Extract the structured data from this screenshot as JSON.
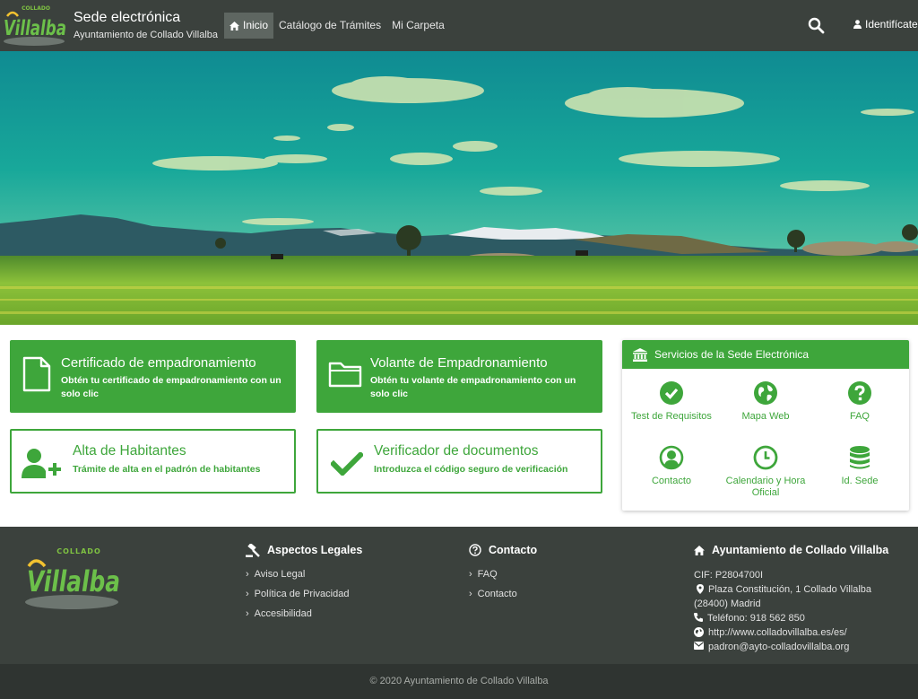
{
  "header": {
    "logo_text": "Villalba",
    "logo_small": "COLLADO",
    "title": "Sede electrónica",
    "subtitle": "Ayuntamiento de Collado Villalba",
    "nav": [
      {
        "label": "Inicio"
      },
      {
        "label": "Catálogo de Trámites"
      },
      {
        "label": "Mi Carpeta"
      }
    ],
    "login_label": "Identifícate",
    "icons": {
      "home": "home-icon",
      "search": "search-icon",
      "user": "user-icon"
    }
  },
  "cards": [
    {
      "title": "Certificado de empadronamiento",
      "desc": "Obtén tu certificado de empadronamiento con un solo clic",
      "icon": "file-icon"
    },
    {
      "title": "Volante de Empadronamiento",
      "desc": "Obtén tu volante de empadronamiento con un solo clic",
      "icon": "folder-icon"
    },
    {
      "title": "Alta de Habitantes",
      "desc": "Trámite de alta en el padrón de habitantes",
      "icon": "user-plus-icon"
    },
    {
      "title": "Verificador de documentos",
      "desc": "Introduzca el código seguro de verificación",
      "icon": "check-icon"
    }
  ],
  "services": {
    "title": "Servicios de la Sede Electrónica",
    "items": [
      {
        "label": "Test de Requisitos",
        "icon": "check-circle-icon"
      },
      {
        "label": "Mapa Web",
        "icon": "globe-icon"
      },
      {
        "label": "FAQ",
        "icon": "question-circle-icon"
      },
      {
        "label": "Contacto",
        "icon": "user-circle-icon"
      },
      {
        "label": "Calendario y Hora Oficial",
        "icon": "clock-icon"
      },
      {
        "label": "Id. Sede",
        "icon": "database-icon"
      }
    ]
  },
  "footer": {
    "legal": {
      "title": "Aspectos Legales",
      "links": [
        "Aviso Legal",
        "Política de Privacidad",
        "Accesibilidad"
      ]
    },
    "contact": {
      "title": "Contacto",
      "links": [
        "FAQ",
        "Contacto"
      ]
    },
    "ayto": {
      "title": "Ayuntamiento de Collado Villalba",
      "cif": "CIF:  P2804700I",
      "address_line1": "Plaza Constitución, 1 Collado Villalba",
      "address_line2": "(28400) Madrid",
      "phone": "Teléfono: 918 562 850",
      "web": "http://www.colladovillalba.es/es/",
      "email": "padron@ayto-colladovillalba.org"
    },
    "copyright": "© 2020 Ayuntamiento de Collado Villalba"
  },
  "colors": {
    "green": "#3ea63b",
    "header_bg": "#3b413d",
    "bottom_bg": "#2f3431"
  }
}
